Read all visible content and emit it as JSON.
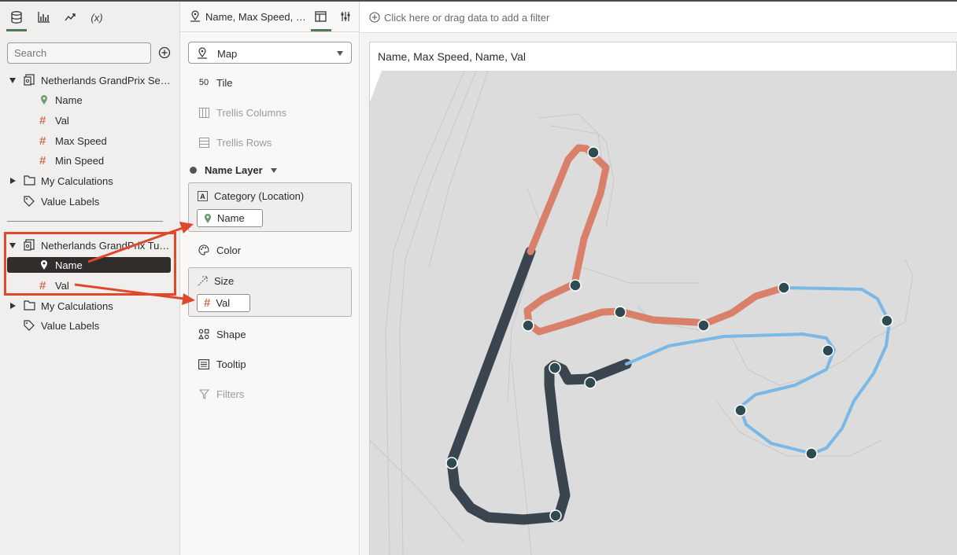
{
  "left_panel": {
    "tabs": [
      "data-icon",
      "visualizations-icon",
      "analytics-icon",
      "calculations-icon"
    ],
    "tab_calc_label": "(x)",
    "search_placeholder": "Search",
    "source1": {
      "name": "Netherlands GrandPrix Sec…",
      "items": [
        "Name",
        "Val",
        "Max Speed",
        "Min Speed"
      ]
    },
    "my_calculations": "My Calculations",
    "value_labels": "Value Labels",
    "source2": {
      "name": "Netherlands GrandPrix Tur…",
      "items": [
        "Name",
        "Val"
      ]
    }
  },
  "grammar": {
    "title": "Name, Max Speed, …",
    "viz_type": "Map",
    "tile": "Tile",
    "trellis_columns": "Trellis Columns",
    "trellis_rows": "Trellis Rows",
    "layer": "Name Layer",
    "category_label": "Category (Location)",
    "category_pill": "Name",
    "color": "Color",
    "size_label": "Size",
    "size_pill": "Val",
    "shape": "Shape",
    "tooltip": "Tooltip",
    "filters": "Filters"
  },
  "canvas": {
    "filter_hint": "Click here or drag data to add a filter",
    "viz_title": "Name, Max Speed, Name, Val"
  },
  "colors": {
    "accent": "#4c7a53",
    "measure": "#d1705a",
    "annotation": "#e0482b",
    "track_orange": "#d9806a",
    "track_blue": "#7ab8e6",
    "track_dark": "#3b4550",
    "marker": "#2d4b50"
  }
}
